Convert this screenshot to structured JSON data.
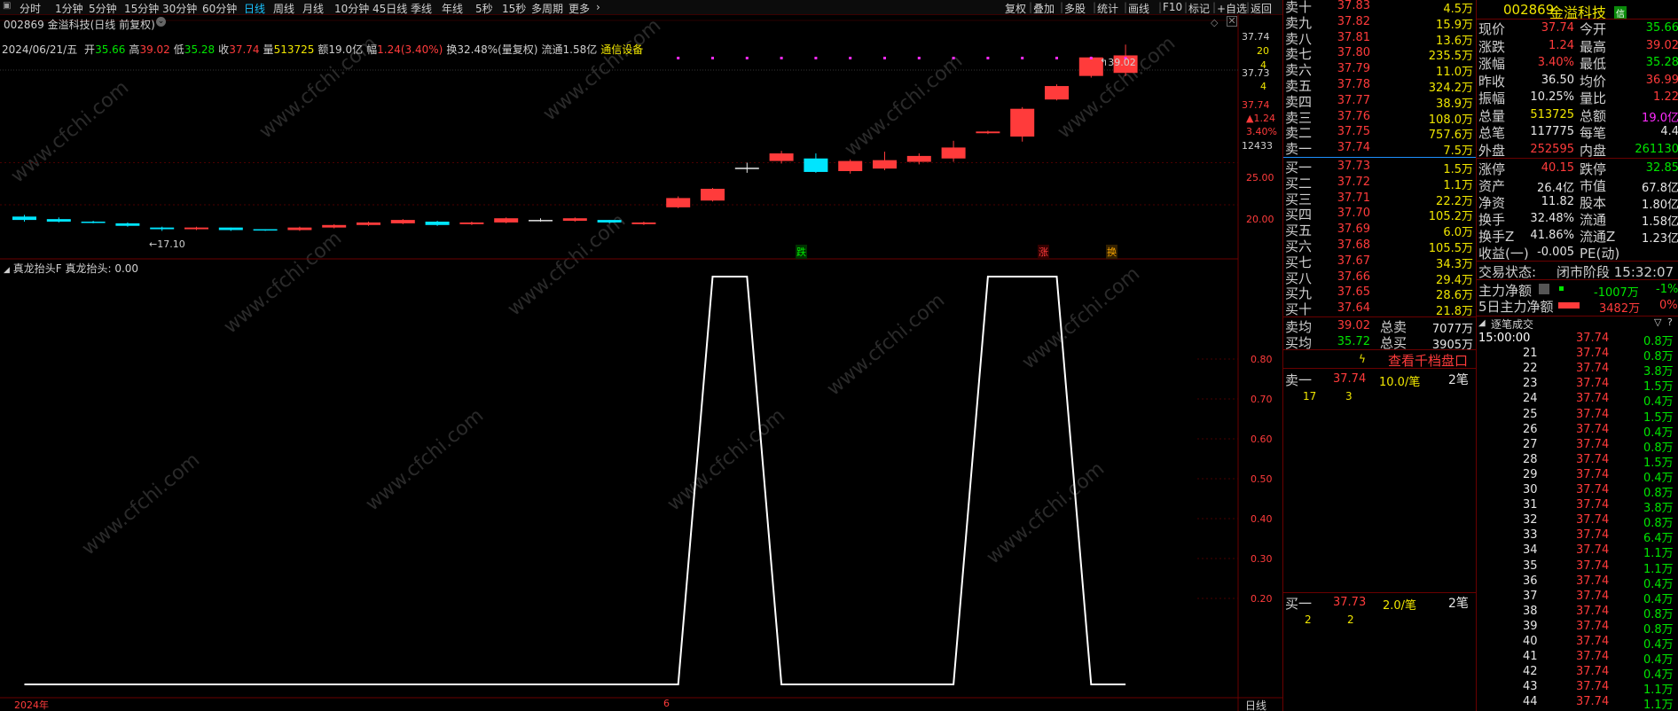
{
  "toolbar": {
    "periods": [
      "分时",
      "1分钟",
      "5分钟",
      "15分钟",
      "30分钟",
      "60分钟",
      "日线",
      "周线",
      "月线",
      "10分钟",
      "45日线",
      "季线",
      "年线",
      "5秒",
      "15秒",
      "多周期",
      "更多"
    ],
    "active_period": "日线",
    "right_items": [
      "复权",
      "叠加",
      "多股",
      "统计",
      "画线",
      "F10",
      "标记",
      "+自选",
      "返回"
    ]
  },
  "chart": {
    "title": "002869 金溢科技(日线 前复权)",
    "info_date": "2024/06/21/五",
    "info": [
      {
        "label": "开",
        "value": "35.66",
        "color": "#00e600"
      },
      {
        "label": "高",
        "value": "39.02",
        "color": "#ff3b3b"
      },
      {
        "label": "低",
        "value": "35.28",
        "color": "#00e600"
      },
      {
        "label": "收",
        "value": "37.74",
        "color": "#ff3b3b"
      },
      {
        "label": "量",
        "value": "513725",
        "color": "#f0e600"
      },
      {
        "label": "额",
        "value": "19.0亿",
        "color": "#d0d0d0"
      },
      {
        "label": "幅",
        "value": "1.24(3.40%)",
        "color": "#ff3b3b"
      },
      {
        "label": "换",
        "value": "32.48%(量复权)",
        "color": "#d0d0d0"
      },
      {
        "label": "流通",
        "value": "1.58亿",
        "color": "#d0d0d0"
      },
      {
        "label": "",
        "value": "通信设备",
        "color": "#f0e600"
      }
    ],
    "price_axis": [
      "37.74",
      "20",
      "4",
      "37.73",
      "4",
      "37.74",
      "▲1.24",
      "3.40%",
      "12433"
    ],
    "y_ticks": [
      "25.00",
      "20.00"
    ],
    "low_marker": "17.10",
    "high_marker": "39.02",
    "event_tags": [
      "跌",
      "涨",
      "换"
    ],
    "year_label": "2024年",
    "month_label": "6",
    "period_label": "日线",
    "indicator_label": "真龙抬头F  真龙抬头: 0.00",
    "indicator_ticks": [
      "0.80",
      "0.70",
      "0.60",
      "0.50",
      "0.40",
      "0.30",
      "0.20"
    ],
    "watermark": "www.cfchi.com"
  },
  "chart_data": {
    "type": "candlestick",
    "candles": [
      {
        "o": 18.6,
        "c": 18.2,
        "h": 18.8,
        "l": 18.0
      },
      {
        "o": 18.3,
        "c": 18.0,
        "h": 18.5,
        "l": 17.9
      },
      {
        "o": 18.0,
        "c": 17.9,
        "h": 18.1,
        "l": 17.8
      },
      {
        "o": 17.8,
        "c": 17.5,
        "h": 17.9,
        "l": 17.4
      },
      {
        "o": 17.3,
        "c": 17.1,
        "h": 17.4,
        "l": 16.9
      },
      {
        "o": 17.1,
        "c": 17.3,
        "h": 17.4,
        "l": 17.0
      },
      {
        "o": 17.3,
        "c": 17.0,
        "h": 17.3,
        "l": 16.9
      },
      {
        "o": 17.1,
        "c": 17.0,
        "h": 17.1,
        "l": 16.9
      },
      {
        "o": 17.0,
        "c": 17.3,
        "h": 17.4,
        "l": 16.9
      },
      {
        "o": 17.3,
        "c": 17.6,
        "h": 17.7,
        "l": 17.2
      },
      {
        "o": 17.6,
        "c": 17.9,
        "h": 18.0,
        "l": 17.5
      },
      {
        "o": 17.8,
        "c": 18.2,
        "h": 18.3,
        "l": 17.7
      },
      {
        "o": 18.0,
        "c": 17.6,
        "h": 18.1,
        "l": 17.5
      },
      {
        "o": 17.7,
        "c": 17.9,
        "h": 18.0,
        "l": 17.6
      },
      {
        "o": 17.9,
        "c": 18.4,
        "h": 18.5,
        "l": 17.8
      },
      {
        "o": 18.2,
        "c": 18.2,
        "h": 18.4,
        "l": 18.0
      },
      {
        "o": 18.1,
        "c": 18.4,
        "h": 18.5,
        "l": 18.0
      },
      {
        "o": 18.2,
        "c": 17.9,
        "h": 18.2,
        "l": 17.8
      },
      {
        "o": 17.7,
        "c": 17.9,
        "h": 18.0,
        "l": 17.6
      },
      {
        "o": 19.7,
        "c": 20.8,
        "h": 21.0,
        "l": 19.6
      },
      {
        "o": 20.5,
        "c": 21.9,
        "h": 22.0,
        "l": 20.4
      },
      {
        "o": 24.4,
        "c": 24.4,
        "h": 25.0,
        "l": 23.8
      },
      {
        "o": 25.2,
        "c": 26.1,
        "h": 26.4,
        "l": 24.9
      },
      {
        "o": 25.5,
        "c": 23.9,
        "h": 26.1,
        "l": 23.8
      },
      {
        "o": 24.0,
        "c": 25.2,
        "h": 25.4,
        "l": 23.7
      },
      {
        "o": 24.3,
        "c": 25.3,
        "h": 26.3,
        "l": 24.1
      },
      {
        "o": 25.1,
        "c": 25.8,
        "h": 26.1,
        "l": 24.8
      },
      {
        "o": 25.5,
        "c": 26.8,
        "h": 27.6,
        "l": 25.1
      },
      {
        "o": 28.5,
        "c": 28.7,
        "h": 28.8,
        "l": 28.4
      },
      {
        "o": 28.1,
        "c": 31.4,
        "h": 31.6,
        "l": 27.5
      },
      {
        "o": 32.5,
        "c": 34.1,
        "h": 34.3,
        "l": 32.4
      },
      {
        "o": 35.3,
        "c": 37.5,
        "h": 37.6,
        "l": 35.1
      },
      {
        "o": 35.66,
        "c": 37.74,
        "h": 39.02,
        "l": 35.28
      }
    ],
    "indicator_points": [
      [
        0,
        0
      ],
      [
        19,
        0
      ],
      [
        20,
        1
      ],
      [
        21,
        1
      ],
      [
        22,
        0
      ],
      [
        27,
        0
      ],
      [
        28,
        1
      ],
      [
        30,
        1
      ],
      [
        31,
        0
      ],
      [
        32,
        0
      ]
    ],
    "ylim": [
      16,
      40
    ]
  },
  "orderbook": {
    "asks": [
      {
        "label": "卖十",
        "price": "37.83",
        "vol": "4.5万"
      },
      {
        "label": "卖九",
        "price": "37.82",
        "vol": "15.9万"
      },
      {
        "label": "卖八",
        "price": "37.81",
        "vol": "13.6万"
      },
      {
        "label": "卖七",
        "price": "37.80",
        "vol": "235.5万"
      },
      {
        "label": "卖六",
        "price": "37.79",
        "vol": "11.0万"
      },
      {
        "label": "卖五",
        "price": "37.78",
        "vol": "324.2万"
      },
      {
        "label": "卖四",
        "price": "37.77",
        "vol": "38.9万"
      },
      {
        "label": "卖三",
        "price": "37.76",
        "vol": "108.0万"
      },
      {
        "label": "卖二",
        "price": "37.75",
        "vol": "757.6万"
      },
      {
        "label": "卖一",
        "price": "37.74",
        "vol": "7.5万"
      }
    ],
    "bids": [
      {
        "label": "买一",
        "price": "37.73",
        "vol": "1.5万"
      },
      {
        "label": "买二",
        "price": "37.72",
        "vol": "1.1万"
      },
      {
        "label": "买三",
        "price": "37.71",
        "vol": "22.2万"
      },
      {
        "label": "买四",
        "price": "37.70",
        "vol": "105.2万"
      },
      {
        "label": "买五",
        "price": "37.69",
        "vol": "6.0万"
      },
      {
        "label": "买六",
        "price": "37.68",
        "vol": "105.5万"
      },
      {
        "label": "买七",
        "price": "37.67",
        "vol": "34.3万"
      },
      {
        "label": "买八",
        "price": "37.66",
        "vol": "29.4万"
      },
      {
        "label": "买九",
        "price": "37.65",
        "vol": "28.6万"
      },
      {
        "label": "买十",
        "price": "37.64",
        "vol": "21.8万"
      }
    ],
    "ask_avg_label": "卖均",
    "ask_avg": "39.02",
    "total_sell_label": "总卖",
    "total_sell": "7077万",
    "bid_avg_label": "买均",
    "bid_avg": "35.72",
    "total_buy_label": "总买",
    "total_buy": "3905万",
    "thousand_link": "查看千档盘口",
    "sell1_label": "卖一",
    "sell1_price": "37.74",
    "sell1_vol": "10.0/笔",
    "sell1_count": "2笔",
    "sell1_q1": "17",
    "sell1_q2": "3",
    "buy1_label": "买一",
    "buy1_price": "37.73",
    "buy1_vol": "2.0/笔",
    "buy1_count": "2笔",
    "buy1_q1": "2",
    "buy1_q2": "2"
  },
  "quote": {
    "code": "002869",
    "name": "金溢科技",
    "badge": "信",
    "rows": [
      [
        {
          "l": "现价",
          "v": "37.74",
          "c": "#ff3b3b"
        },
        {
          "l": "今开",
          "v": "35.66",
          "c": "#00e600"
        }
      ],
      [
        {
          "l": "涨跌",
          "v": "1.24",
          "c": "#ff3b3b"
        },
        {
          "l": "最高",
          "v": "39.02",
          "c": "#ff3b3b"
        }
      ],
      [
        {
          "l": "涨幅",
          "v": "3.40%",
          "c": "#ff3b3b"
        },
        {
          "l": "最低",
          "v": "35.28",
          "c": "#00e600"
        }
      ],
      [
        {
          "l": "昨收",
          "v": "36.50",
          "c": "#e6e6e6"
        },
        {
          "l": "均价",
          "v": "36.99",
          "c": "#ff3b3b"
        }
      ],
      [
        {
          "l": "振幅",
          "v": "10.25%",
          "c": "#e6e6e6"
        },
        {
          "l": "量比",
          "v": "1.22",
          "c": "#ff3b3b"
        }
      ],
      [
        {
          "l": "总量",
          "v": "513725",
          "c": "#f0e600"
        },
        {
          "l": "总额",
          "v": "19.0亿",
          "c": "#ff2bff"
        }
      ],
      [
        {
          "l": "总笔",
          "v": "117775",
          "c": "#e6e6e6"
        },
        {
          "l": "每笔",
          "v": "4.4",
          "c": "#e6e6e6"
        }
      ],
      [
        {
          "l": "外盘",
          "v": "252595",
          "c": "#ff3b3b"
        },
        {
          "l": "内盘",
          "v": "261130",
          "c": "#00e600"
        }
      ],
      [
        {
          "l": "涨停",
          "v": "40.15",
          "c": "#ff3b3b"
        },
        {
          "l": "跌停",
          "v": "32.85",
          "c": "#00e600"
        }
      ],
      [
        {
          "l": "资产",
          "v": "26.4亿",
          "c": "#e6e6e6"
        },
        {
          "l": "市值",
          "v": "67.8亿",
          "c": "#e6e6e6"
        }
      ],
      [
        {
          "l": "净资",
          "v": "11.82",
          "c": "#e6e6e6"
        },
        {
          "l": "股本",
          "v": "1.80亿",
          "c": "#e6e6e6"
        }
      ],
      [
        {
          "l": "换手",
          "v": "32.48%",
          "c": "#e6e6e6"
        },
        {
          "l": "流通",
          "v": "1.58亿",
          "c": "#e6e6e6"
        }
      ],
      [
        {
          "l": "换手Z",
          "v": "41.86%",
          "c": "#e6e6e6"
        },
        {
          "l": "流通Z",
          "v": "1.23亿",
          "c": "#e6e6e6"
        }
      ],
      [
        {
          "l": "收益(一)",
          "v": "-0.005",
          "c": "#e6e6e6"
        },
        {
          "l": "PE(动)",
          "v": "",
          "c": "#e6e6e6"
        }
      ]
    ],
    "status_label": "交易状态:",
    "status_value": "闭市阶段 15:32:07",
    "main_flow_label": "主力净额",
    "main_flow_value": "-1007万",
    "main_flow_pct": "-1%",
    "main5_label": "5日主力净额",
    "main5_value": "3482万",
    "main5_pct": "0%",
    "ticks_title": "逐笔成交",
    "ticks": [
      {
        "t": "15:00:00",
        "p": "37.74",
        "v": "0.8万",
        "c": "#00e600"
      },
      {
        "t": "21",
        "p": "37.74",
        "v": "0.8万",
        "c": "#00e600"
      },
      {
        "t": "22",
        "p": "37.74",
        "v": "3.8万",
        "c": "#00e600"
      },
      {
        "t": "23",
        "p": "37.74",
        "v": "1.5万",
        "c": "#00e600"
      },
      {
        "t": "24",
        "p": "37.74",
        "v": "0.4万",
        "c": "#00e600"
      },
      {
        "t": "25",
        "p": "37.74",
        "v": "1.5万",
        "c": "#00e600"
      },
      {
        "t": "26",
        "p": "37.74",
        "v": "0.4万",
        "c": "#00e600"
      },
      {
        "t": "27",
        "p": "37.74",
        "v": "0.8万",
        "c": "#00e600"
      },
      {
        "t": "28",
        "p": "37.74",
        "v": "1.5万",
        "c": "#00e600"
      },
      {
        "t": "29",
        "p": "37.74",
        "v": "0.4万",
        "c": "#00e600"
      },
      {
        "t": "30",
        "p": "37.74",
        "v": "0.8万",
        "c": "#00e600"
      },
      {
        "t": "31",
        "p": "37.74",
        "v": "3.8万",
        "c": "#00e600"
      },
      {
        "t": "32",
        "p": "37.74",
        "v": "0.8万",
        "c": "#00e600"
      },
      {
        "t": "33",
        "p": "37.74",
        "v": "6.4万",
        "c": "#00e600"
      },
      {
        "t": "34",
        "p": "37.74",
        "v": "1.1万",
        "c": "#00e600"
      },
      {
        "t": "35",
        "p": "37.74",
        "v": "1.1万",
        "c": "#00e600"
      },
      {
        "t": "36",
        "p": "37.74",
        "v": "0.4万",
        "c": "#00e600"
      },
      {
        "t": "37",
        "p": "37.74",
        "v": "0.4万",
        "c": "#00e600"
      },
      {
        "t": "38",
        "p": "37.74",
        "v": "0.8万",
        "c": "#00e600"
      },
      {
        "t": "39",
        "p": "37.74",
        "v": "0.8万",
        "c": "#00e600"
      },
      {
        "t": "40",
        "p": "37.74",
        "v": "0.4万",
        "c": "#00e600"
      },
      {
        "t": "41",
        "p": "37.74",
        "v": "0.4万",
        "c": "#00e600"
      },
      {
        "t": "42",
        "p": "37.74",
        "v": "0.4万",
        "c": "#00e600"
      },
      {
        "t": "43",
        "p": "37.74",
        "v": "1.1万",
        "c": "#00e600"
      },
      {
        "t": "44",
        "p": "37.74",
        "v": "1.1万",
        "c": "#00e600"
      }
    ]
  }
}
